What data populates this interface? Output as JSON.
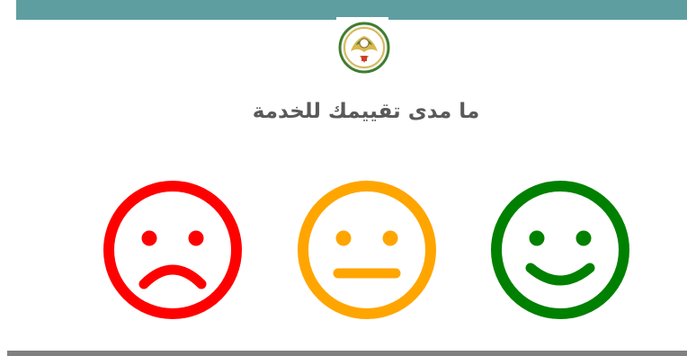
{
  "header": {
    "title": "ما مدى تقييمك للخدمة",
    "logo_icon": "uae-ministry-emblem-icon"
  },
  "rating": {
    "options": [
      {
        "label": "",
        "icon": "sad-face-icon",
        "color": "#ff0000"
      },
      {
        "label": "",
        "icon": "neutral-face-icon",
        "color": "#ffa500"
      },
      {
        "label": "",
        "icon": "happy-face-icon",
        "color": "#008000"
      }
    ]
  },
  "colors": {
    "top_bar": "#5f9ea0",
    "bottom_line": "#808080",
    "title_text": "#595959"
  }
}
